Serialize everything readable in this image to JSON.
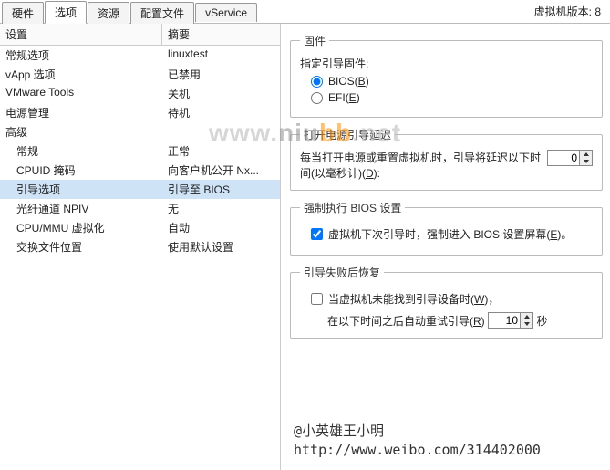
{
  "tabs": [
    "硬件",
    "选项",
    "资源",
    "配置文件",
    "vService"
  ],
  "active_tab": 1,
  "version_label": "虚拟机版本: 8",
  "list_headers": {
    "setting": "设置",
    "summary": "摘要"
  },
  "rows": [
    {
      "s": "常规选项",
      "z": "linuxtest",
      "indent": false,
      "selected": false
    },
    {
      "s": "vApp 选项",
      "z": "已禁用",
      "indent": false,
      "selected": false
    },
    {
      "s": "VMware Tools",
      "z": "关机",
      "indent": false,
      "selected": false
    },
    {
      "s": "电源管理",
      "z": "待机",
      "indent": false,
      "selected": false
    },
    {
      "s": "高级",
      "z": "",
      "indent": false,
      "selected": false
    },
    {
      "s": "常规",
      "z": "正常",
      "indent": true,
      "selected": false
    },
    {
      "s": "CPUID 掩码",
      "z": "向客户机公开 Nx...",
      "indent": true,
      "selected": false
    },
    {
      "s": "引导选项",
      "z": "引导至 BIOS",
      "indent": true,
      "selected": true
    },
    {
      "s": "光纤通道 NPIV",
      "z": "无",
      "indent": true,
      "selected": false
    },
    {
      "s": "CPU/MMU 虚拟化",
      "z": "自动",
      "indent": true,
      "selected": false
    },
    {
      "s": "交换文件位置",
      "z": "使用默认设置",
      "indent": true,
      "selected": false
    }
  ],
  "firmware": {
    "legend": "固件",
    "prompt": "指定引导固件:",
    "bios_label": "BIOS(B)",
    "efi_label": "EFI(E)",
    "selected": "bios"
  },
  "delay": {
    "legend": "打开电源引导延迟",
    "text1": "每当打开电源或重置虚拟机时，引导将延迟以下时",
    "text2": "间(以毫秒计)(D):",
    "value": "0"
  },
  "force_bios": {
    "legend": "强制执行 BIOS 设置",
    "checked": true,
    "label": "虚拟机下次引导时，强制进入 BIOS 设置屏幕(E)。"
  },
  "fail": {
    "legend": "引导失败后恢复",
    "checked": false,
    "label": "当虚拟机未能找到引导设备时(W)，",
    "inner_before": "在以下时间之后自动重试引导(R)",
    "value": "10",
    "inner_after": "秒"
  },
  "watermark": {
    "a": "www.",
    "b": "niu",
    "c": "bb",
    "d": ".net"
  },
  "credit": {
    "line1": "@小英雄王小明",
    "line2": "http://www.weibo.com/314402000"
  }
}
